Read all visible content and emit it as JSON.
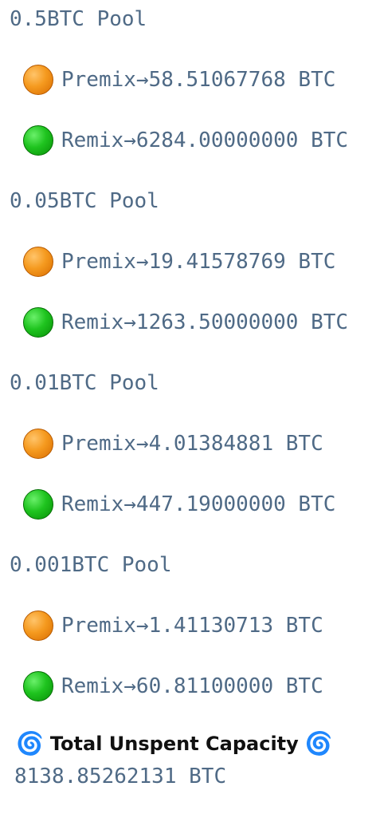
{
  "pools": [
    {
      "title": "0.5BTC Pool",
      "premix": {
        "icon": "orange-circle-icon",
        "text": "Premix→58.51067768 BTC"
      },
      "remix": {
        "icon": "green-circle-icon",
        "text": "Remix→6284.00000000 BTC"
      }
    },
    {
      "title": "0.05BTC Pool",
      "premix": {
        "icon": "orange-circle-icon",
        "text": "Premix→19.41578769 BTC"
      },
      "remix": {
        "icon": "green-circle-icon",
        "text": "Remix→1263.50000000 BTC"
      }
    },
    {
      "title": "0.01BTC Pool",
      "premix": {
        "icon": "orange-circle-icon",
        "text": "Premix→4.01384881 BTC"
      },
      "remix": {
        "icon": "green-circle-icon",
        "text": "Remix→447.19000000 BTC"
      }
    },
    {
      "title": "0.001BTC Pool",
      "premix": {
        "icon": "orange-circle-icon",
        "text": "Premix→1.41130713 BTC"
      },
      "remix": {
        "icon": "green-circle-icon",
        "text": "Remix→60.81100000 BTC"
      }
    }
  ],
  "total": {
    "label": "Total Unspent Capacity",
    "icon_left": "cyclone-icon",
    "icon_right": "cyclone-icon",
    "value": "8138.85262131 BTC"
  },
  "colors": {
    "text": "#4f6a86",
    "premix_dot": "#f08a10",
    "remix_dot": "#17b517",
    "spiral": "#1e6fe0"
  }
}
